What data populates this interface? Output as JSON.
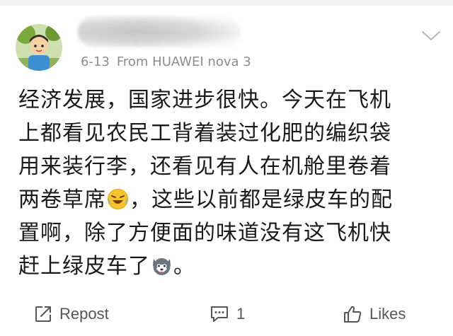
{
  "post": {
    "date": "6-13",
    "source": "From HUAWEI nova 3",
    "content": {
      "line1": "经济发展，国家进步很快。今天在飞机",
      "line2": "上都看见农民工背着装过化肥的编织袋",
      "line3": "用来装行李，还看见有人在机舱里卷着",
      "line4_a": "两卷草席",
      "line4_b": "，这些以前都是绿皮车的配",
      "line5": "置啊，除了方便面的味道没有这飞机快",
      "line6_a": "赶上绿皮车了",
      "line6_b": "。"
    }
  },
  "actions": {
    "repost_label": "Repost",
    "comment_count": "1",
    "likes_label": "Likes"
  },
  "icons": {
    "avatar": "cartoon-avatar",
    "menu": "chevron-down-icon",
    "emoji1": "laughing-crying-emoji",
    "emoji2": "husky-emoji",
    "repost": "repost-icon",
    "comment": "comment-icon",
    "like": "thumbs-up-icon"
  },
  "colors": {
    "meta_text": "#8c8c8c",
    "action_text": "#555555",
    "body_text": "#1a1a1a"
  }
}
